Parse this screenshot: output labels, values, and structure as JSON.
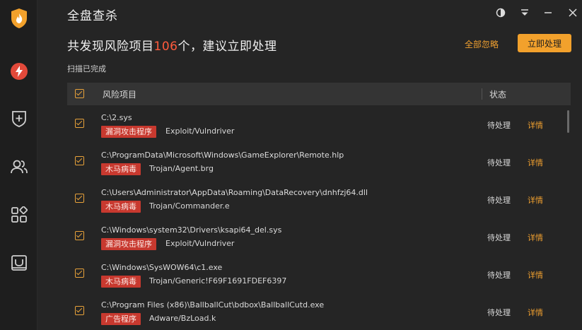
{
  "window": {
    "title": "全盘查杀"
  },
  "sidebar": {
    "items": [
      {
        "icon": "shield-logo-icon"
      },
      {
        "icon": "lightning-icon",
        "active": true
      },
      {
        "icon": "shield-plus-icon"
      },
      {
        "icon": "users-icon"
      },
      {
        "icon": "apps-icon"
      },
      {
        "icon": "box-icon"
      }
    ]
  },
  "summary": {
    "prefix": "共发现风险项目",
    "count": "106",
    "suffix": "个，建议立即处理",
    "scan_status": "扫描已完成"
  },
  "actions": {
    "ignore_all": "全部忽略",
    "process_now": "立即处理"
  },
  "table": {
    "col_risk": "风险项目",
    "col_status": "状态",
    "rows": [
      {
        "path": "C:\\2.sys",
        "tag": "漏洞攻击程序",
        "threat": "Exploit/Vulndriver",
        "status": "待处理",
        "detail": "详情"
      },
      {
        "path": "C:\\ProgramData\\Microsoft\\Windows\\GameExplorer\\Remote.hlp",
        "tag": "木马病毒",
        "threat": "Trojan/Agent.brg",
        "status": "待处理",
        "detail": "详情"
      },
      {
        "path": "C:\\Users\\Administrator\\AppData\\Roaming\\DataRecovery\\dnhfzj64.dll",
        "tag": "木马病毒",
        "threat": "Trojan/Commander.e",
        "status": "待处理",
        "detail": "详情"
      },
      {
        "path": "C:\\Windows\\system32\\Drivers\\ksapi64_del.sys",
        "tag": "漏洞攻击程序",
        "threat": "Exploit/Vulndriver",
        "status": "待处理",
        "detail": "详情"
      },
      {
        "path": "C:\\Windows\\SysWOW64\\c1.exe",
        "tag": "木马病毒",
        "threat": "Trojan/Generic!F69F1691FDEF6397",
        "status": "待处理",
        "detail": "详情"
      },
      {
        "path": "C:\\Program Files (x86)\\BallballCut\\bdbox\\BallballCutd.exe",
        "tag": "广告程序",
        "threat": "Adware/BzLoad.k",
        "status": "待处理",
        "detail": "详情"
      }
    ]
  },
  "colors": {
    "accent": "#f2a12c",
    "danger_tag": "#c8392f",
    "count": "#ff5a3c",
    "background": "#252525",
    "sidebar": "#1e1e1e"
  }
}
